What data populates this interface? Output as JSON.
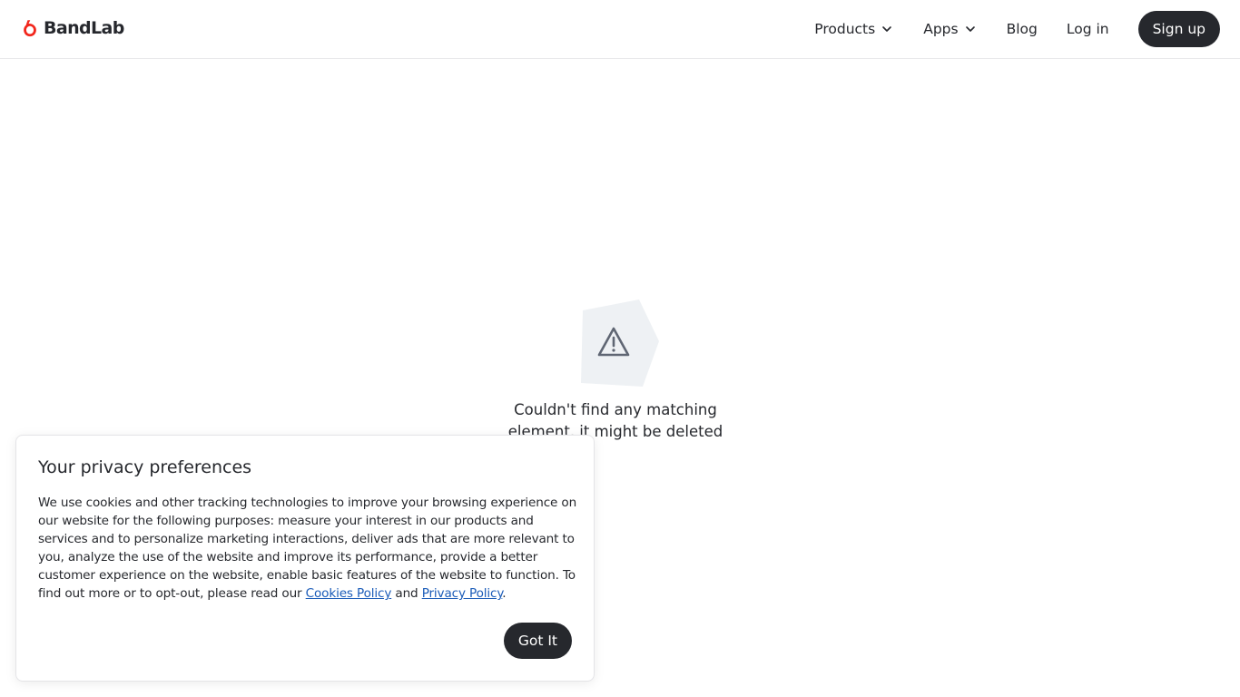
{
  "header": {
    "brand": "BandLab",
    "nav": {
      "products": "Products",
      "apps": "Apps",
      "blog": "Blog",
      "login": "Log in",
      "signup": "Sign up"
    }
  },
  "empty_state": {
    "message": "Couldn't find any matching element, it might be deleted"
  },
  "cookie_banner": {
    "title": "Your privacy preferences",
    "body_prefix": "We use cookies and other tracking technologies to improve your browsing experience on our website for the following purposes: measure your interest in our products and services and to personalize marketing interactions, deliver ads that are more relevant to you, analyze the use of the website and improve its performance, provide a better customer experience on the website, enable basic features of the website to function. To find out more or to opt-out, please read our ",
    "cookies_policy_link": "Cookies Policy",
    "and_text": " and ",
    "privacy_policy_link": "Privacy Policy",
    "period": ".",
    "accept_button": "Got It"
  },
  "colors": {
    "brand_red": "#f2261c",
    "dark": "#26282d",
    "link": "#1a5bb8",
    "icon_bg": "#eef1f4",
    "icon_stroke": "#5f6673"
  },
  "icons": {
    "logo": "bandlab-logo-icon",
    "products_chevron": "chevron-down-icon",
    "apps_chevron": "chevron-down-icon",
    "empty_state": "warning-triangle-icon"
  }
}
